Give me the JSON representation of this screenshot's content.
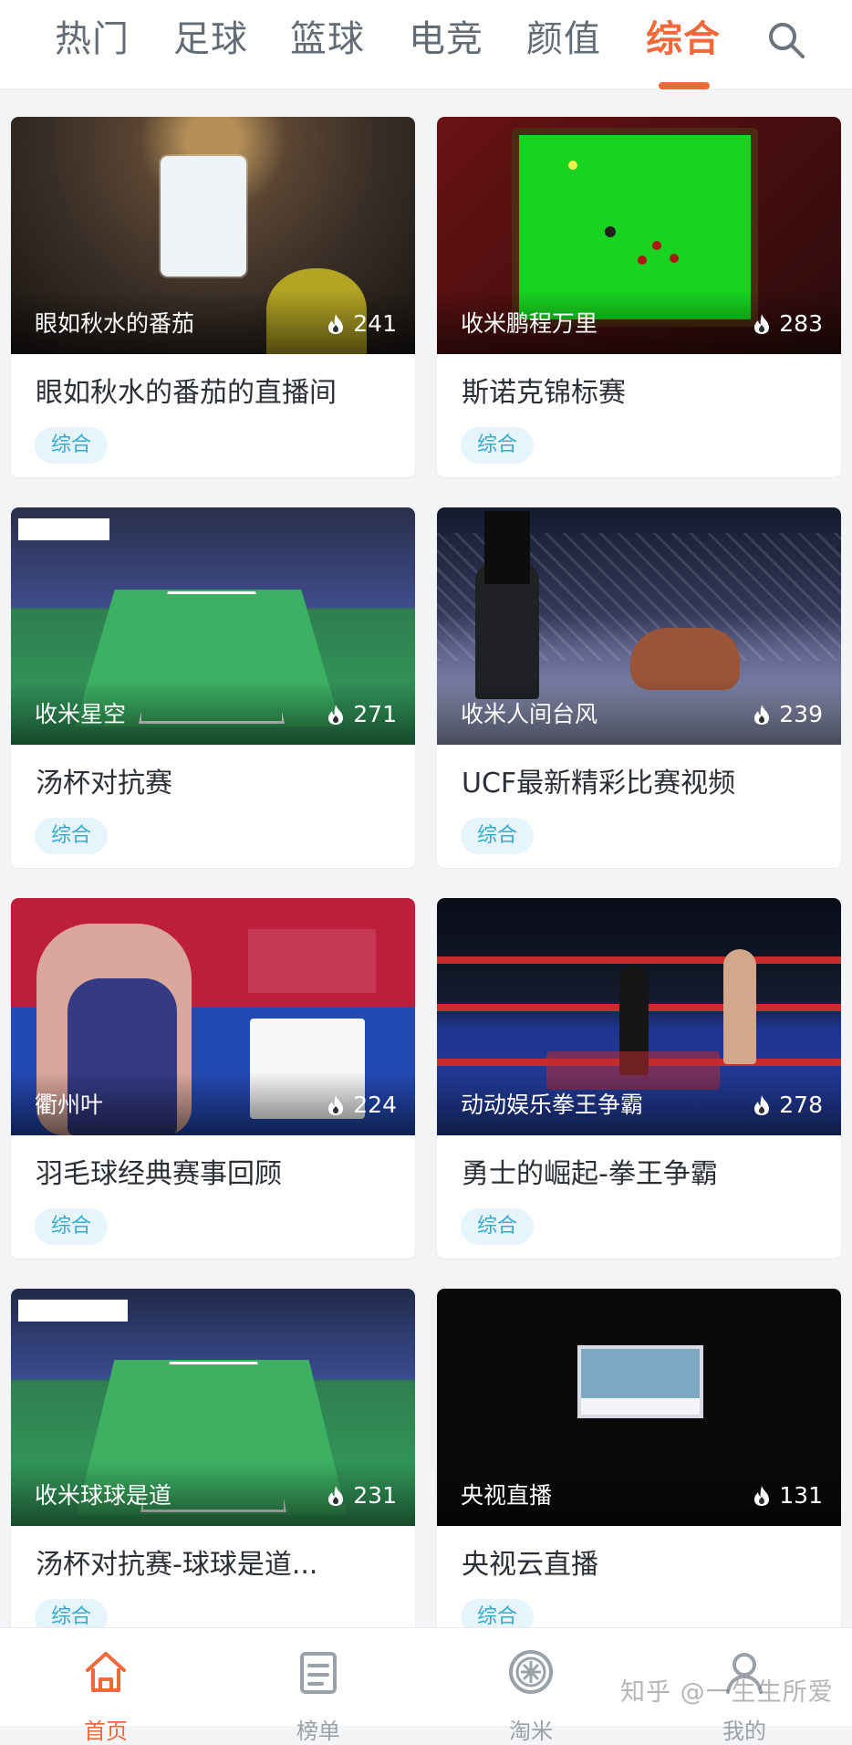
{
  "tabs": [
    "热门",
    "足球",
    "篮球",
    "电竞",
    "颜值",
    "综合"
  ],
  "active_tab_index": 5,
  "search": {
    "icon": "search-icon"
  },
  "colors": {
    "accent": "#f0693a",
    "tag_bg": "#e6f5fb",
    "tag_text": "#37aad0",
    "page_bg": "#f3f4f6"
  },
  "cards": [
    {
      "host": "眼如秋水的番茄",
      "heat": "241",
      "title": "眼如秋水的番茄的直播间",
      "tag": "综合"
    },
    {
      "host": "收米鹏程万里",
      "heat": "283",
      "title": "斯诺克锦标赛",
      "tag": "综合"
    },
    {
      "host": "收米星空",
      "heat": "271",
      "title": "汤杯对抗赛",
      "tag": "综合"
    },
    {
      "host": "收米人间台风",
      "heat": "239",
      "title": "UCF最新精彩比赛视频",
      "tag": "综合"
    },
    {
      "host": "衢州叶",
      "heat": "224",
      "title": "羽毛球经典赛事回顾",
      "tag": "综合"
    },
    {
      "host": "动动娱乐拳王争霸",
      "heat": "278",
      "title": "勇士的崛起-拳王争霸",
      "tag": "综合"
    },
    {
      "host": "收米球球是道",
      "heat": "231",
      "title": "汤杯对抗赛-球球是道...",
      "tag": "综合"
    },
    {
      "host": "央视直播",
      "heat": "131",
      "title": "央视云直播",
      "tag": "综合"
    }
  ],
  "bottom_nav": [
    {
      "label": "首页",
      "icon": "home-icon"
    },
    {
      "label": "榜单",
      "icon": "list-icon"
    },
    {
      "label": "淘米",
      "icon": "rice-icon"
    },
    {
      "label": "我的",
      "icon": "profile-icon"
    }
  ],
  "watermark": "知乎 @一生生所爱"
}
